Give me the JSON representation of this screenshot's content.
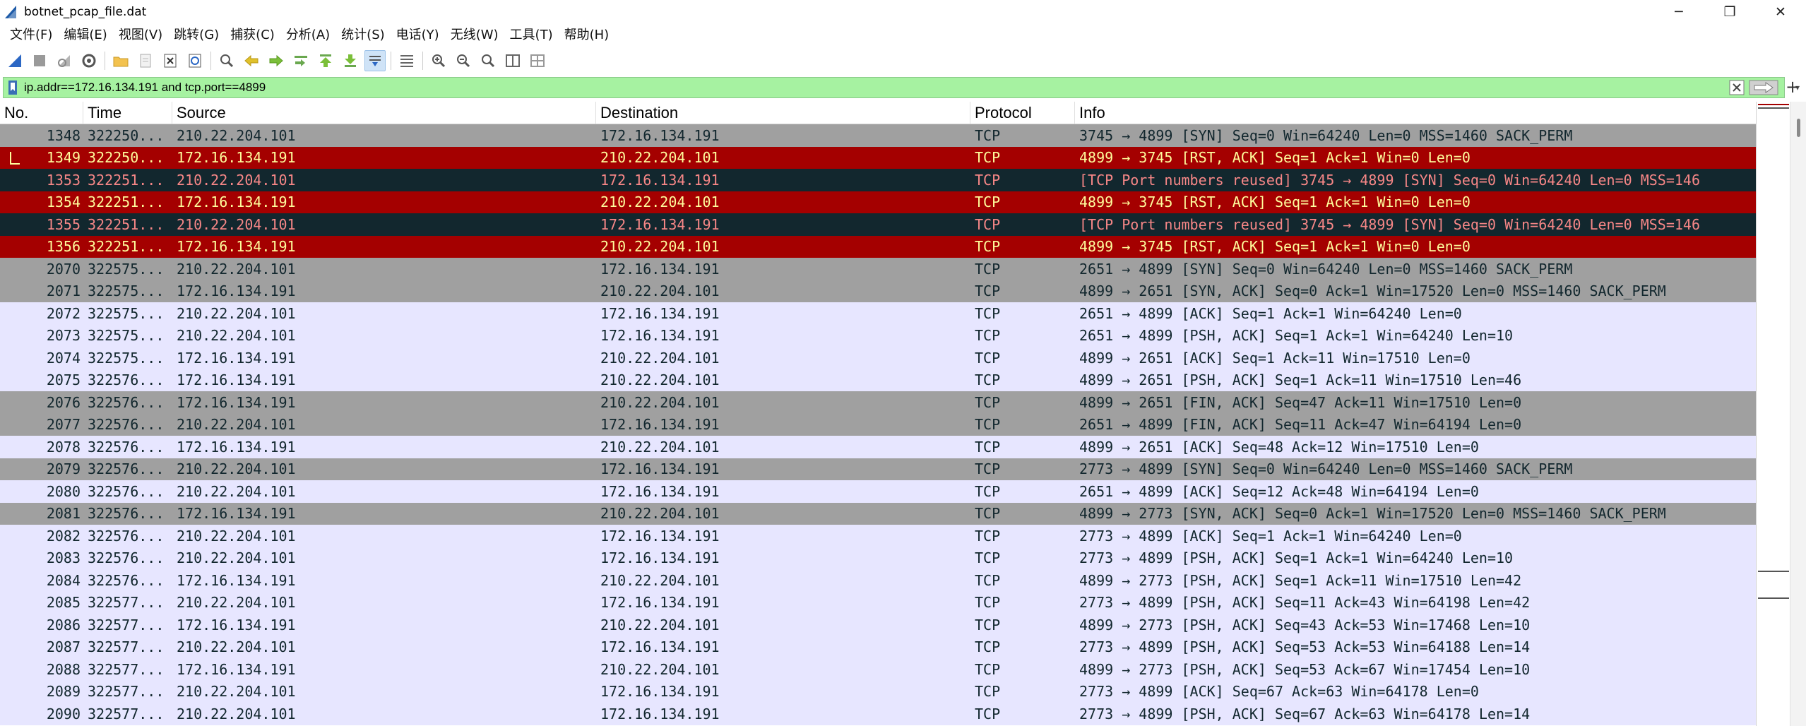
{
  "window": {
    "title": "botnet_pcap_file.dat",
    "minimize": "─",
    "restore": "❐",
    "close": "✕"
  },
  "menu": [
    "文件(F)",
    "编辑(E)",
    "视图(V)",
    "跳转(G)",
    "捕获(C)",
    "分析(A)",
    "统计(S)",
    "电话(Y)",
    "无线(W)",
    "工具(T)",
    "帮助(H)"
  ],
  "toolbar_icons": [
    "start-capture-icon",
    "stop-capture-icon",
    "restart-capture-icon",
    "capture-options-icon",
    "open-file-icon",
    "save-file-icon",
    "close-file-icon",
    "reload-file-icon",
    "find-packet-icon",
    "go-back-icon",
    "go-forward-icon",
    "go-to-packet-icon",
    "first-packet-icon",
    "last-packet-icon",
    "autoscroll-icon",
    "colorize-icon",
    "zoom-in-icon",
    "zoom-out-icon",
    "normal-size-icon",
    "resize-columns-icon",
    "expand-icon"
  ],
  "filter": {
    "value": "ip.addr==172.16.134.191 and tcp.port==4899",
    "add_label": "+"
  },
  "columns": [
    "No.",
    "Time",
    "Source",
    "Destination",
    "Protocol",
    "Info"
  ],
  "colors": {
    "gray": {
      "bg": "#a0a0a0",
      "fg": "#12272e"
    },
    "red": {
      "bg": "#a40000",
      "fg": "#fffc9c"
    },
    "dark": {
      "bg": "#12272e",
      "fg": "#f78787"
    },
    "lavender": {
      "bg": "#e7e6ff",
      "fg": "#12272e"
    }
  },
  "packets": [
    {
      "no": "1348",
      "time": "322250...",
      "src": "210.22.204.101",
      "dst": "172.16.134.191",
      "proto": "TCP",
      "info": "3745 → 4899 [SYN] Seq=0 Win=64240 Len=0 MSS=1460 SACK_PERM",
      "color": "gray"
    },
    {
      "no": "1349",
      "time": "322250...",
      "src": "172.16.134.191",
      "dst": "210.22.204.101",
      "proto": "TCP",
      "info": "4899 → 3745 [RST, ACK] Seq=1 Ack=1 Win=0 Len=0",
      "color": "red"
    },
    {
      "no": "1353",
      "time": "322251...",
      "src": "210.22.204.101",
      "dst": "172.16.134.191",
      "proto": "TCP",
      "info": "[TCP Port numbers reused] 3745 → 4899 [SYN] Seq=0 Win=64240 Len=0 MSS=146",
      "color": "dark"
    },
    {
      "no": "1354",
      "time": "322251...",
      "src": "172.16.134.191",
      "dst": "210.22.204.101",
      "proto": "TCP",
      "info": "4899 → 3745 [RST, ACK] Seq=1 Ack=1 Win=0 Len=0",
      "color": "red"
    },
    {
      "no": "1355",
      "time": "322251...",
      "src": "210.22.204.101",
      "dst": "172.16.134.191",
      "proto": "TCP",
      "info": "[TCP Port numbers reused] 3745 → 4899 [SYN] Seq=0 Win=64240 Len=0 MSS=146",
      "color": "dark"
    },
    {
      "no": "1356",
      "time": "322251...",
      "src": "172.16.134.191",
      "dst": "210.22.204.101",
      "proto": "TCP",
      "info": "4899 → 3745 [RST, ACK] Seq=1 Ack=1 Win=0 Len=0",
      "color": "red"
    },
    {
      "no": "2070",
      "time": "322575...",
      "src": "210.22.204.101",
      "dst": "172.16.134.191",
      "proto": "TCP",
      "info": "2651 → 4899 [SYN] Seq=0 Win=64240 Len=0 MSS=1460 SACK_PERM",
      "color": "gray"
    },
    {
      "no": "2071",
      "time": "322575...",
      "src": "172.16.134.191",
      "dst": "210.22.204.101",
      "proto": "TCP",
      "info": "4899 → 2651 [SYN, ACK] Seq=0 Ack=1 Win=17520 Len=0 MSS=1460 SACK_PERM",
      "color": "gray"
    },
    {
      "no": "2072",
      "time": "322575...",
      "src": "210.22.204.101",
      "dst": "172.16.134.191",
      "proto": "TCP",
      "info": "2651 → 4899 [ACK] Seq=1 Ack=1 Win=64240 Len=0",
      "color": "lavender"
    },
    {
      "no": "2073",
      "time": "322575...",
      "src": "210.22.204.101",
      "dst": "172.16.134.191",
      "proto": "TCP",
      "info": "2651 → 4899 [PSH, ACK] Seq=1 Ack=1 Win=64240 Len=10",
      "color": "lavender"
    },
    {
      "no": "2074",
      "time": "322575...",
      "src": "172.16.134.191",
      "dst": "210.22.204.101",
      "proto": "TCP",
      "info": "4899 → 2651 [ACK] Seq=1 Ack=11 Win=17510 Len=0",
      "color": "lavender"
    },
    {
      "no": "2075",
      "time": "322576...",
      "src": "172.16.134.191",
      "dst": "210.22.204.101",
      "proto": "TCP",
      "info": "4899 → 2651 [PSH, ACK] Seq=1 Ack=11 Win=17510 Len=46",
      "color": "lavender"
    },
    {
      "no": "2076",
      "time": "322576...",
      "src": "172.16.134.191",
      "dst": "210.22.204.101",
      "proto": "TCP",
      "info": "4899 → 2651 [FIN, ACK] Seq=47 Ack=11 Win=17510 Len=0",
      "color": "gray"
    },
    {
      "no": "2077",
      "time": "322576...",
      "src": "210.22.204.101",
      "dst": "172.16.134.191",
      "proto": "TCP",
      "info": "2651 → 4899 [FIN, ACK] Seq=11 Ack=47 Win=64194 Len=0",
      "color": "gray"
    },
    {
      "no": "2078",
      "time": "322576...",
      "src": "172.16.134.191",
      "dst": "210.22.204.101",
      "proto": "TCP",
      "info": "4899 → 2651 [ACK] Seq=48 Ack=12 Win=17510 Len=0",
      "color": "lavender"
    },
    {
      "no": "2079",
      "time": "322576...",
      "src": "210.22.204.101",
      "dst": "172.16.134.191",
      "proto": "TCP",
      "info": "2773 → 4899 [SYN] Seq=0 Win=64240 Len=0 MSS=1460 SACK_PERM",
      "color": "gray"
    },
    {
      "no": "2080",
      "time": "322576...",
      "src": "210.22.204.101",
      "dst": "172.16.134.191",
      "proto": "TCP",
      "info": "2651 → 4899 [ACK] Seq=12 Ack=48 Win=64194 Len=0",
      "color": "lavender"
    },
    {
      "no": "2081",
      "time": "322576...",
      "src": "172.16.134.191",
      "dst": "210.22.204.101",
      "proto": "TCP",
      "info": "4899 → 2773 [SYN, ACK] Seq=0 Ack=1 Win=17520 Len=0 MSS=1460 SACK_PERM",
      "color": "gray"
    },
    {
      "no": "2082",
      "time": "322576...",
      "src": "210.22.204.101",
      "dst": "172.16.134.191",
      "proto": "TCP",
      "info": "2773 → 4899 [ACK] Seq=1 Ack=1 Win=64240 Len=0",
      "color": "lavender"
    },
    {
      "no": "2083",
      "time": "322576...",
      "src": "210.22.204.101",
      "dst": "172.16.134.191",
      "proto": "TCP",
      "info": "2773 → 4899 [PSH, ACK] Seq=1 Ack=1 Win=64240 Len=10",
      "color": "lavender"
    },
    {
      "no": "2084",
      "time": "322576...",
      "src": "172.16.134.191",
      "dst": "210.22.204.101",
      "proto": "TCP",
      "info": "4899 → 2773 [PSH, ACK] Seq=1 Ack=11 Win=17510 Len=42",
      "color": "lavender"
    },
    {
      "no": "2085",
      "time": "322577...",
      "src": "210.22.204.101",
      "dst": "172.16.134.191",
      "proto": "TCP",
      "info": "2773 → 4899 [PSH, ACK] Seq=11 Ack=43 Win=64198 Len=42",
      "color": "lavender"
    },
    {
      "no": "2086",
      "time": "322577...",
      "src": "172.16.134.191",
      "dst": "210.22.204.101",
      "proto": "TCP",
      "info": "4899 → 2773 [PSH, ACK] Seq=43 Ack=53 Win=17468 Len=10",
      "color": "lavender"
    },
    {
      "no": "2087",
      "time": "322577...",
      "src": "210.22.204.101",
      "dst": "172.16.134.191",
      "proto": "TCP",
      "info": "2773 → 4899 [PSH, ACK] Seq=53 Ack=53 Win=64188 Len=14",
      "color": "lavender"
    },
    {
      "no": "2088",
      "time": "322577...",
      "src": "172.16.134.191",
      "dst": "210.22.204.101",
      "proto": "TCP",
      "info": "4899 → 2773 [PSH, ACK] Seq=53 Ack=67 Win=17454 Len=10",
      "color": "lavender"
    },
    {
      "no": "2089",
      "time": "322577...",
      "src": "210.22.204.101",
      "dst": "172.16.134.191",
      "proto": "TCP",
      "info": "2773 → 4899 [ACK] Seq=67 Ack=63 Win=64178 Len=0",
      "color": "lavender"
    },
    {
      "no": "2090",
      "time": "322577...",
      "src": "210.22.204.101",
      "dst": "172.16.134.191",
      "proto": "TCP",
      "info": "2773 → 4899 [PSH, ACK] Seq=67 Ack=63 Win=64178 Len=14",
      "color": "lavender"
    }
  ]
}
